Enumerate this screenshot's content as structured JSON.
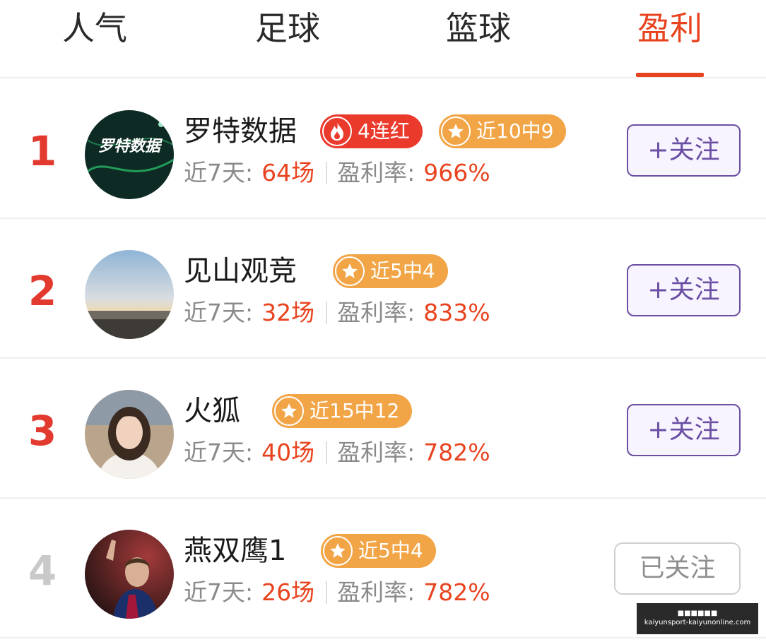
{
  "tabs": [
    {
      "label": "人气",
      "active": false
    },
    {
      "label": "足球",
      "active": false
    },
    {
      "label": "篮球",
      "active": false
    },
    {
      "label": "盈利",
      "active": true
    }
  ],
  "colors": {
    "accent": "#e8431f",
    "rank_top": "#e23a2f",
    "follow_purple": "#6a4fa3",
    "badge_red": "#ea3a2c",
    "badge_orange": "#f2a546"
  },
  "rows": [
    {
      "rank": "1",
      "name": "罗特数据",
      "avatar_text": "罗特数据",
      "badges": [
        {
          "icon": "flame-icon",
          "text": "4连红",
          "color": "red"
        },
        {
          "icon": "star-icon",
          "text": "近10中9",
          "color": "orange"
        }
      ],
      "stats": {
        "games_label": "近7天:",
        "games_value": "64场",
        "profit_label": "盈利率:",
        "profit_value": "966%"
      },
      "follow_label": "+关注",
      "followed": false
    },
    {
      "rank": "2",
      "name": "见山观竞",
      "badges": [
        {
          "icon": "star-icon",
          "text": "近5中4",
          "color": "orange"
        }
      ],
      "stats": {
        "games_label": "近7天:",
        "games_value": "32场",
        "profit_label": "盈利率:",
        "profit_value": "833%"
      },
      "follow_label": "+关注",
      "followed": false
    },
    {
      "rank": "3",
      "name": "火狐",
      "badges": [
        {
          "icon": "star-icon",
          "text": "近15中12",
          "color": "orange"
        }
      ],
      "stats": {
        "games_label": "近7天:",
        "games_value": "40场",
        "profit_label": "盈利率:",
        "profit_value": "782%"
      },
      "follow_label": "+关注",
      "followed": false
    },
    {
      "rank": "4",
      "name": "燕双鹰1",
      "badges": [
        {
          "icon": "star-icon",
          "text": "近5中4",
          "color": "orange"
        }
      ],
      "stats": {
        "games_label": "近7天:",
        "games_value": "26场",
        "profit_label": "盈利率:",
        "profit_value": "782%"
      },
      "follow_label": "已关注",
      "followed": true
    }
  ],
  "watermark": {
    "line1": "■■■■■■",
    "line2": "kaiyunsport-kaiyunonline.com"
  }
}
